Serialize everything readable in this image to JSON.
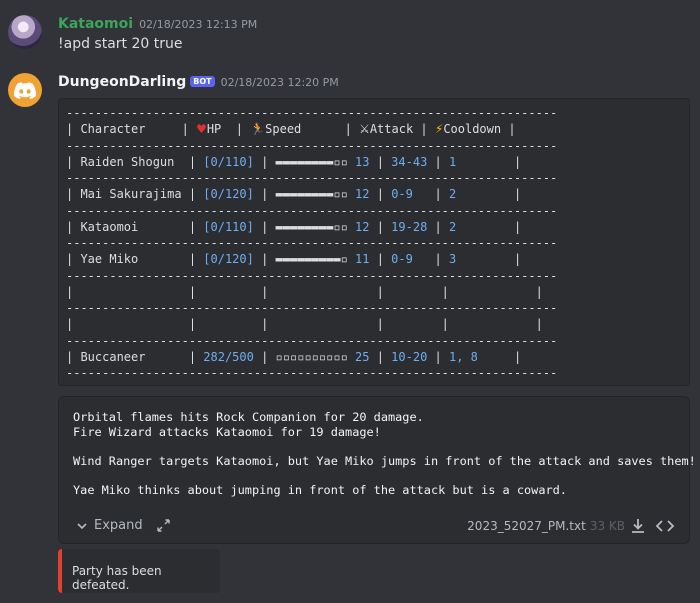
{
  "messages": [
    {
      "username": "Kataomoi",
      "timestamp": "02/18/2023 12:13 PM",
      "content": "!apd start 20 true"
    },
    {
      "username": "DungeonDarling",
      "badge": "BOT",
      "timestamp": "02/18/2023 12:20 PM"
    }
  ],
  "table": {
    "separator": "--------------------------------------------------------------------",
    "header": {
      "character": "Character",
      "hp": "HP",
      "speed": "Speed",
      "attack": "Attack",
      "cooldown": "Cooldown"
    },
    "rows": [
      {
        "name": "Raiden Shogun",
        "hp": "[0/110]",
        "speed_bar": "▬▬▬▬▬▬▬▬▫▫",
        "speed": "13",
        "attack": "34-43",
        "cooldown": "1"
      },
      {
        "name": "Mai Sakurajima",
        "hp": "[0/120]",
        "speed_bar": "▬▬▬▬▬▬▬▬▫▫",
        "speed": "12",
        "attack": "0-9",
        "cooldown": "2"
      },
      {
        "name": "Kataomoi",
        "hp": "[0/110]",
        "speed_bar": "▬▬▬▬▬▬▬▬▫▫",
        "speed": "12",
        "attack": "19-28",
        "cooldown": "2"
      },
      {
        "name": "Yae Miko",
        "hp": "[0/120]",
        "speed_bar": "▬▬▬▬▬▬▬▬▬▫",
        "speed": "11",
        "attack": "0-9",
        "cooldown": "3"
      },
      {
        "name": "Buccaneer",
        "hp": "282/500",
        "speed_bar": "▫▫▫▫▫▫▫▫▫▫",
        "speed": "25",
        "attack": "10-20",
        "cooldown": "1, 8"
      }
    ]
  },
  "attachment": {
    "lines": [
      "Orbital flames hits Rock Companion for 20 damage.",
      "Fire Wizard attacks Kataomoi for 19 damage!",
      "",
      "Wind Ranger targets Kataomoi, but Yae Miko jumps in front of the attack and saves them!",
      "",
      "Yae Miko thinks about jumping in front of the attack but is a coward."
    ],
    "expand_label": "Expand",
    "filename": "2023_52027_PM.txt",
    "filesize": "33 KB"
  },
  "embed": {
    "text": "Party has been defeated.",
    "color": "#e2412f"
  },
  "icons": {
    "expand": "chevron-down-icon",
    "fullscreen": "expand-arrows-icon",
    "download": "download-icon",
    "view_code": "code-icon",
    "bot_avatar": "discord-logo-icon"
  }
}
